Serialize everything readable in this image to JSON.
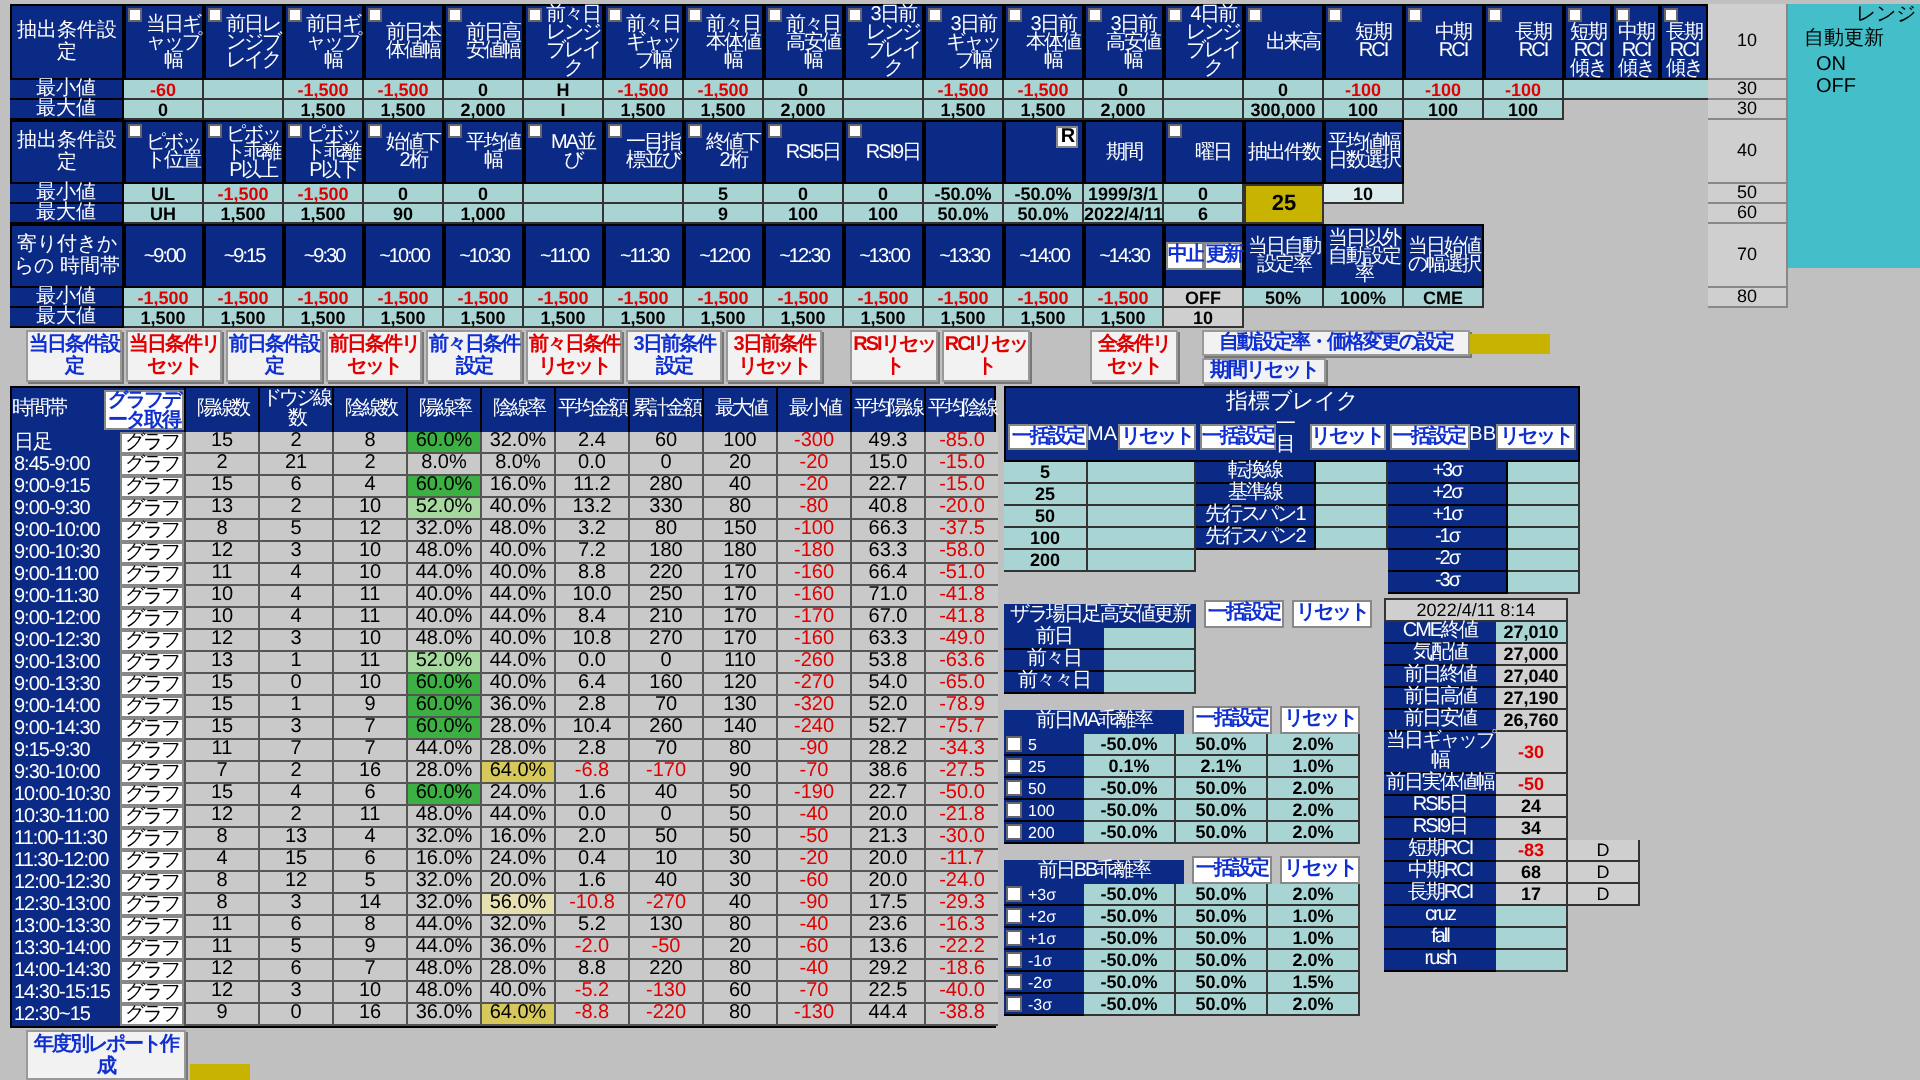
{
  "price_conditions": {
    "title": "抽出条件設定",
    "min_label": "最小値",
    "max_label": "最大値",
    "columns": [
      {
        "label": "当日ギャップ幅",
        "checked": false,
        "min": "-60",
        "min_negative": true,
        "max": "0"
      },
      {
        "label": "前日レンジブレイク",
        "checked": false
      },
      {
        "label": "前日ギャップ幅",
        "checked": false,
        "min": "-1,500",
        "min_negative": true,
        "max": "1,500"
      },
      {
        "label": "前日本体値幅",
        "checked": false,
        "min": "-1,500",
        "min_negative": true,
        "max": "1,500"
      },
      {
        "label": "前日高安値幅",
        "checked": false,
        "min": "0",
        "min_negative": false,
        "max": "2,000"
      },
      {
        "label": "前々日レンジブレイク",
        "checked": false,
        "min": "H",
        "min_negative": false,
        "max": "I"
      },
      {
        "label": "前々日ギャップ幅",
        "checked": false,
        "min": "-1,500",
        "min_negative": true,
        "max": "1,500"
      },
      {
        "label": "前々日本体値幅",
        "checked": false,
        "min": "-1,500",
        "min_negative": true,
        "max": "1,500"
      },
      {
        "label": "前々日高安値幅",
        "checked": false,
        "min": "0",
        "min_negative": false,
        "max": "2,000"
      },
      {
        "label": "3日前レンジブレイク",
        "checked": false
      },
      {
        "label": "3日前ギャップ幅",
        "checked": false,
        "min": "-1,500",
        "min_negative": true,
        "max": "1,500"
      },
      {
        "label": "3日前本体値幅",
        "checked": false,
        "min": "-1,500",
        "min_negative": true,
        "max": "1,500"
      },
      {
        "label": "3日前高安値幅",
        "checked": false,
        "min": "0",
        "min_negative": false,
        "max": "2,000"
      },
      {
        "label": "4日前レンジブレイク",
        "checked": false
      },
      {
        "label": "出来高",
        "checked": false,
        "min": "0",
        "min_negative": false,
        "max": "300,000"
      },
      {
        "label": "短期RCI",
        "checked": false,
        "min": "-100",
        "min_negative": true,
        "max": "100"
      },
      {
        "label": "中期RCI",
        "checked": false,
        "min": "-100",
        "min_negative": true,
        "max": "100"
      },
      {
        "label": "長期RCI",
        "checked": false,
        "min": "-100",
        "min_negative": true,
        "max": "100"
      }
    ],
    "slope_columns": [
      {
        "label": "短期RCI傾き",
        "checked": false
      },
      {
        "label": "中期RCI傾き",
        "checked": false
      },
      {
        "label": "長期RCI傾き",
        "checked": false
      }
    ]
  },
  "pattern_conditions": {
    "title": "抽出条件設定",
    "min_label": "最小値",
    "max_label": "最大値",
    "columns": [
      {
        "kind": "header",
        "label": "ピボット位置",
        "checked": false,
        "min": "UL",
        "min_negative": false,
        "max": "UH"
      },
      {
        "kind": "header",
        "label": "ピボット乖離P以上",
        "checked": false,
        "min": "-1,500",
        "min_negative": true,
        "max": "1,500"
      },
      {
        "kind": "header",
        "label": "ピボット乖離P以下",
        "checked": false,
        "min": "-1,500",
        "min_negative": true,
        "max": "1,500"
      },
      {
        "kind": "header",
        "label": "始値下2桁",
        "checked": false,
        "min": "0",
        "min_negative": false,
        "max": "90"
      },
      {
        "kind": "header",
        "label": "平均値幅",
        "checked": false,
        "min": "0",
        "min_negative": false,
        "max": "1,000"
      },
      {
        "kind": "header",
        "label": "MA並び",
        "checked": false
      },
      {
        "kind": "header",
        "label": "一目指標並び",
        "checked": false
      },
      {
        "kind": "header",
        "label": "終値下2桁",
        "checked": false,
        "min": "5",
        "min_negative": false,
        "max": "9"
      },
      {
        "kind": "header",
        "label": "RSI5日",
        "checked": false,
        "min": "0",
        "min_negative": false,
        "max": "100"
      },
      {
        "kind": "header",
        "label": "RSI9日",
        "checked": false,
        "min": "0",
        "min_negative": false,
        "max": "100"
      },
      {
        "kind": "blank",
        "min": "-50.0%",
        "min_negative": false,
        "max": "50.0%"
      },
      {
        "kind": "button",
        "label": "R",
        "min": "-50.0%",
        "min_negative": false,
        "max": "50.0%"
      },
      {
        "kind": "header",
        "label": "期間",
        "min": "1999/3/1",
        "min_negative": false,
        "max": "2022/4/11"
      },
      {
        "kind": "header",
        "label": "曜日",
        "checked": false,
        "min": "0",
        "min_negative": false,
        "max": "6"
      }
    ],
    "count": {
      "label": "抽出件数",
      "value": "25"
    },
    "avg_days": {
      "label": "平均値幅日数選択",
      "value": "10"
    }
  },
  "time_conditions": {
    "title": "寄り付きからの 時間帯",
    "min_label": "最小値",
    "max_label": "最大値",
    "slots": [
      {
        "label": "~9:00",
        "min": "-1,500",
        "min_negative": true,
        "max": "1,500"
      },
      {
        "label": "~9:15",
        "min": "-1,500",
        "min_negative": true,
        "max": "1,500"
      },
      {
        "label": "~9:30",
        "min": "-1,500",
        "min_negative": true,
        "max": "1,500"
      },
      {
        "label": "~10:00",
        "min": "-1,500",
        "min_negative": true,
        "max": "1,500"
      },
      {
        "label": "~10:30",
        "min": "-1,500",
        "min_negative": true,
        "max": "1,500"
      },
      {
        "label": "~11:00",
        "min": "-1,500",
        "min_negative": true,
        "max": "1,500"
      },
      {
        "label": "~11:30",
        "min": "-1,500",
        "min_negative": true,
        "max": "1,500"
      },
      {
        "label": "~12:00",
        "min": "-1,500",
        "min_negative": true,
        "max": "1,500"
      },
      {
        "label": "~12:30",
        "min": "-1,500",
        "min_negative": true,
        "max": "1,500"
      },
      {
        "label": "~13:00",
        "min": "-1,500",
        "min_negative": true,
        "max": "1,500"
      },
      {
        "label": "~13:30",
        "min": "-1,500",
        "min_negative": true,
        "max": "1,500"
      },
      {
        "label": "~14:00",
        "min": "-1,500",
        "min_negative": true,
        "max": "1,500"
      },
      {
        "label": "~14:30",
        "min": "-1,500",
        "min_negative": true,
        "max": "1,500"
      }
    ],
    "stop_button": "中止",
    "update_button": "更新",
    "mode": "OFF",
    "interval": "10",
    "rates": [
      {
        "label": "当日自動設定率",
        "value": "50%"
      },
      {
        "label": "当日以外自動設定率",
        "value": "100%"
      },
      {
        "label": "当日始値の幅選択",
        "value": "CME"
      }
    ]
  },
  "level_list": [
    "10",
    "30",
    "30",
    "40",
    "50",
    "60",
    "70",
    "80"
  ],
  "auto_update": {
    "range_label": "レンジ",
    "title": "自動更新",
    "options": [
      "ON",
      "OFF"
    ]
  },
  "condition_buttons": [
    {
      "label": "当日条件設定",
      "kind": "set"
    },
    {
      "label": "当日条件リセット",
      "kind": "reset"
    },
    {
      "label": "前日条件設定",
      "kind": "set"
    },
    {
      "label": "前日条件リセット",
      "kind": "reset"
    },
    {
      "label": "前々日条件設定",
      "kind": "set"
    },
    {
      "label": "前々日条件リセット",
      "kind": "reset"
    },
    {
      "label": "3日前条件設定",
      "kind": "set"
    },
    {
      "label": "3日前条件リセット",
      "kind": "reset"
    }
  ],
  "indicator_reset_buttons": [
    {
      "label": "RSIリセット",
      "kind": "reset"
    },
    {
      "label": "RCIリセット",
      "kind": "reset"
    }
  ],
  "all_reset_button": "全条件リセット",
  "auto_rate_button": "自動設定率・価格変更の設定",
  "period_reset_button": "期間リセット",
  "table": {
    "time_header": "時間帯",
    "fetch_button": "グラフデータ取得",
    "columns": [
      {
        "label": "陽線数",
        "kind": "plain"
      },
      {
        "label": "ドウジ線数",
        "kind": "plain"
      },
      {
        "label": "陰線数",
        "kind": "plain"
      },
      {
        "label": "陽線率",
        "kind": "up_rate"
      },
      {
        "label": "陰線率",
        "kind": "down_rate"
      },
      {
        "label": "平均金額",
        "kind": "amount"
      },
      {
        "label": "累計金額",
        "kind": "amount"
      },
      {
        "label": "最大値",
        "kind": "plain"
      },
      {
        "label": "最小値",
        "kind": "negative"
      },
      {
        "label": "平均陽線",
        "kind": "plain"
      },
      {
        "label": "平均陰線",
        "kind": "negative"
      }
    ],
    "rows": [
      {
        "label": "日足",
        "button": "グラフ",
        "cells": [
          "15",
          "2",
          "8",
          "60.0%",
          "32.0%",
          "2.4",
          "60",
          "100",
          "-300",
          "49.3",
          "-85.0"
        ],
        "up_hit": true,
        "up_near": false,
        "down_hit": false,
        "down_near": false,
        "loss": false
      },
      {
        "label": "8:45-9:00",
        "button": "グラフ",
        "cells": [
          "2",
          "21",
          "2",
          "8.0%",
          "8.0%",
          "0.0",
          "0",
          "20",
          "-20",
          "15.0",
          "-15.0"
        ],
        "up_hit": false,
        "up_near": false,
        "down_hit": false,
        "down_near": false,
        "loss": false
      },
      {
        "label": "9:00-9:15",
        "button": "グラフ",
        "cells": [
          "15",
          "6",
          "4",
          "60.0%",
          "16.0%",
          "11.2",
          "280",
          "40",
          "-20",
          "22.7",
          "-15.0"
        ],
        "up_hit": true,
        "up_near": false,
        "down_hit": false,
        "down_near": false,
        "loss": false
      },
      {
        "label": "9:00-9:30",
        "button": "グラフ",
        "cells": [
          "13",
          "2",
          "10",
          "52.0%",
          "40.0%",
          "13.2",
          "330",
          "80",
          "-80",
          "40.8",
          "-20.0"
        ],
        "up_hit": false,
        "up_near": true,
        "down_hit": false,
        "down_near": false,
        "loss": false
      },
      {
        "label": "9:00-10:00",
        "button": "グラフ",
        "cells": [
          "8",
          "5",
          "12",
          "32.0%",
          "48.0%",
          "3.2",
          "80",
          "150",
          "-100",
          "66.3",
          "-37.5"
        ],
        "up_hit": false,
        "up_near": false,
        "down_hit": false,
        "down_near": false,
        "loss": false
      },
      {
        "label": "9:00-10:30",
        "button": "グラフ",
        "cells": [
          "12",
          "3",
          "10",
          "48.0%",
          "40.0%",
          "7.2",
          "180",
          "180",
          "-180",
          "63.3",
          "-58.0"
        ],
        "up_hit": false,
        "up_near": false,
        "down_hit": false,
        "down_near": false,
        "loss": false
      },
      {
        "label": "9:00-11:00",
        "button": "グラフ",
        "cells": [
          "11",
          "4",
          "10",
          "44.0%",
          "40.0%",
          "8.8",
          "220",
          "170",
          "-160",
          "66.4",
          "-51.0"
        ],
        "up_hit": false,
        "up_near": false,
        "down_hit": false,
        "down_near": false,
        "loss": false
      },
      {
        "label": "9:00-11:30",
        "button": "グラフ",
        "cells": [
          "10",
          "4",
          "11",
          "40.0%",
          "44.0%",
          "10.0",
          "250",
          "170",
          "-160",
          "71.0",
          "-41.8"
        ],
        "up_hit": false,
        "up_near": false,
        "down_hit": false,
        "down_near": false,
        "loss": false
      },
      {
        "label": "9:00-12:00",
        "button": "グラフ",
        "cells": [
          "10",
          "4",
          "11",
          "40.0%",
          "44.0%",
          "8.4",
          "210",
          "170",
          "-170",
          "67.0",
          "-41.8"
        ],
        "up_hit": false,
        "up_near": false,
        "down_hit": false,
        "down_near": false,
        "loss": false
      },
      {
        "label": "9:00-12:30",
        "button": "グラフ",
        "cells": [
          "12",
          "3",
          "10",
          "48.0%",
          "40.0%",
          "10.8",
          "270",
          "170",
          "-160",
          "63.3",
          "-49.0"
        ],
        "up_hit": false,
        "up_near": false,
        "down_hit": false,
        "down_near": false,
        "loss": false
      },
      {
        "label": "9:00-13:00",
        "button": "グラフ",
        "cells": [
          "13",
          "1",
          "11",
          "52.0%",
          "44.0%",
          "0.0",
          "0",
          "110",
          "-260",
          "53.8",
          "-63.6"
        ],
        "up_hit": false,
        "up_near": true,
        "down_hit": false,
        "down_near": false,
        "loss": false
      },
      {
        "label": "9:00-13:30",
        "button": "グラフ",
        "cells": [
          "15",
          "0",
          "10",
          "60.0%",
          "40.0%",
          "6.4",
          "160",
          "120",
          "-270",
          "54.0",
          "-65.0"
        ],
        "up_hit": true,
        "up_near": false,
        "down_hit": false,
        "down_near": false,
        "loss": false
      },
      {
        "label": "9:00-14:00",
        "button": "グラフ",
        "cells": [
          "15",
          "1",
          "9",
          "60.0%",
          "36.0%",
          "2.8",
          "70",
          "130",
          "-320",
          "52.0",
          "-78.9"
        ],
        "up_hit": true,
        "up_near": false,
        "down_hit": false,
        "down_near": false,
        "loss": false
      },
      {
        "label": "9:00-14:30",
        "button": "グラフ",
        "cells": [
          "15",
          "3",
          "7",
          "60.0%",
          "28.0%",
          "10.4",
          "260",
          "140",
          "-240",
          "52.7",
          "-75.7"
        ],
        "up_hit": true,
        "up_near": false,
        "down_hit": false,
        "down_near": false,
        "loss": false
      },
      {
        "label": "9:15-9:30",
        "button": "グラフ",
        "cells": [
          "11",
          "7",
          "7",
          "44.0%",
          "28.0%",
          "2.8",
          "70",
          "80",
          "-90",
          "28.2",
          "-34.3"
        ],
        "up_hit": false,
        "up_near": false,
        "down_hit": false,
        "down_near": false,
        "loss": false
      },
      {
        "label": "9:30-10:00",
        "button": "グラフ",
        "cells": [
          "7",
          "2",
          "16",
          "28.0%",
          "64.0%",
          "-6.8",
          "-170",
          "90",
          "-70",
          "38.6",
          "-27.5"
        ],
        "up_hit": false,
        "up_near": false,
        "down_hit": true,
        "down_near": false,
        "loss": true
      },
      {
        "label": "10:00-10:30",
        "button": "グラフ",
        "cells": [
          "15",
          "4",
          "6",
          "60.0%",
          "24.0%",
          "1.6",
          "40",
          "50",
          "-190",
          "22.7",
          "-50.0"
        ],
        "up_hit": true,
        "up_near": false,
        "down_hit": false,
        "down_near": false,
        "loss": false
      },
      {
        "label": "10:30-11:00",
        "button": "グラフ",
        "cells": [
          "12",
          "2",
          "11",
          "48.0%",
          "44.0%",
          "0.0",
          "0",
          "50",
          "-40",
          "20.0",
          "-21.8"
        ],
        "up_hit": false,
        "up_near": false,
        "down_hit": false,
        "down_near": false,
        "loss": false
      },
      {
        "label": "11:00-11:30",
        "button": "グラフ",
        "cells": [
          "8",
          "13",
          "4",
          "32.0%",
          "16.0%",
          "2.0",
          "50",
          "50",
          "-50",
          "21.3",
          "-30.0"
        ],
        "up_hit": false,
        "up_near": false,
        "down_hit": false,
        "down_near": false,
        "loss": false
      },
      {
        "label": "11:30-12:00",
        "button": "グラフ",
        "cells": [
          "4",
          "15",
          "6",
          "16.0%",
          "24.0%",
          "0.4",
          "10",
          "30",
          "-20",
          "20.0",
          "-11.7"
        ],
        "up_hit": false,
        "up_near": false,
        "down_hit": false,
        "down_near": false,
        "loss": false
      },
      {
        "label": "12:00-12:30",
        "button": "グラフ",
        "cells": [
          "8",
          "12",
          "5",
          "32.0%",
          "20.0%",
          "1.6",
          "40",
          "30",
          "-60",
          "20.0",
          "-24.0"
        ],
        "up_hit": false,
        "up_near": false,
        "down_hit": false,
        "down_near": false,
        "loss": false
      },
      {
        "label": "12:30-13:00",
        "button": "グラフ",
        "cells": [
          "8",
          "3",
          "14",
          "32.0%",
          "56.0%",
          "-10.8",
          "-270",
          "40",
          "-90",
          "17.5",
          "-29.3"
        ],
        "up_hit": false,
        "up_near": false,
        "down_hit": false,
        "down_near": true,
        "loss": true
      },
      {
        "label": "13:00-13:30",
        "button": "グラフ",
        "cells": [
          "11",
          "6",
          "8",
          "44.0%",
          "32.0%",
          "5.2",
          "130",
          "80",
          "-40",
          "23.6",
          "-16.3"
        ],
        "up_hit": false,
        "up_near": false,
        "down_hit": false,
        "down_near": false,
        "loss": false
      },
      {
        "label": "13:30-14:00",
        "button": "グラフ",
        "cells": [
          "11",
          "5",
          "9",
          "44.0%",
          "36.0%",
          "-2.0",
          "-50",
          "20",
          "-60",
          "13.6",
          "-22.2"
        ],
        "up_hit": false,
        "up_near": false,
        "down_hit": false,
        "down_near": false,
        "loss": true
      },
      {
        "label": "14:00-14:30",
        "button": "グラフ",
        "cells": [
          "12",
          "6",
          "7",
          "48.0%",
          "28.0%",
          "8.8",
          "220",
          "80",
          "-40",
          "29.2",
          "-18.6"
        ],
        "up_hit": false,
        "up_near": false,
        "down_hit": false,
        "down_near": false,
        "loss": false
      },
      {
        "label": "14:30-15:15",
        "button": "グラフ",
        "cells": [
          "12",
          "3",
          "10",
          "48.0%",
          "40.0%",
          "-5.2",
          "-130",
          "60",
          "-70",
          "22.5",
          "-40.0"
        ],
        "up_hit": false,
        "up_near": false,
        "down_hit": false,
        "down_near": false,
        "loss": true
      },
      {
        "label": "12:30~15",
        "button": "グラフ",
        "cells": [
          "9",
          "0",
          "16",
          "36.0%",
          "64.0%",
          "-8.8",
          "-220",
          "80",
          "-130",
          "44.4",
          "-38.8"
        ],
        "up_hit": false,
        "up_near": false,
        "down_hit": true,
        "down_near": false,
        "loss": true
      }
    ]
  },
  "report_button": "年度別レポート作成",
  "indicator_break": {
    "title": "指標ブレイク",
    "groups": [
      {
        "label": "MA",
        "set_button": "一括設定",
        "reset_button": "リセット",
        "kind": "value_label",
        "rows": [
          "5",
          "25",
          "50",
          "100",
          "200"
        ]
      },
      {
        "label": "一目",
        "set_button": "一括設定",
        "reset_button": "リセット",
        "kind": "name_label",
        "rows": [
          "転換線",
          "基準線",
          "先行スパン1",
          "先行スパン2"
        ]
      },
      {
        "label": "BB",
        "set_button": "一括設定",
        "reset_button": "リセット",
        "kind": "name_label",
        "rows": [
          "+3σ",
          "+2σ",
          "+1σ",
          "-1σ",
          "-2σ",
          "-3σ"
        ]
      }
    ]
  },
  "zaraba": {
    "title": "ザラ場日足高安値更新",
    "set_button": "一括設定",
    "reset_button": "リセット",
    "rows": [
      "前日",
      "前々日",
      "前々々日"
    ]
  },
  "ma_deviation": {
    "title": "前日MA乖離率",
    "set_button": "一括設定",
    "reset_button": "リセット",
    "rows": [
      {
        "label": "5",
        "checked": false,
        "values": [
          "-50.0%",
          "50.0%",
          "2.0%"
        ]
      },
      {
        "label": "25",
        "checked": false,
        "values": [
          "0.1%",
          "2.1%",
          "1.0%"
        ]
      },
      {
        "label": "50",
        "checked": false,
        "values": [
          "-50.0%",
          "50.0%",
          "2.0%"
        ]
      },
      {
        "label": "100",
        "checked": false,
        "values": [
          "-50.0%",
          "50.0%",
          "2.0%"
        ]
      },
      {
        "label": "200",
        "checked": false,
        "values": [
          "-50.0%",
          "50.0%",
          "2.0%"
        ]
      }
    ]
  },
  "bb_deviation": {
    "title": "前日BB乖離率",
    "set_button": "一括設定",
    "reset_button": "リセット",
    "rows": [
      {
        "label": "+3σ",
        "checked": false,
        "values": [
          "-50.0%",
          "50.0%",
          "2.0%"
        ]
      },
      {
        "label": "+2σ",
        "checked": false,
        "values": [
          "-50.0%",
          "50.0%",
          "1.0%"
        ]
      },
      {
        "label": "+1σ",
        "checked": false,
        "values": [
          "-50.0%",
          "50.0%",
          "1.0%"
        ]
      },
      {
        "label": "-1σ",
        "checked": false,
        "values": [
          "-50.0%",
          "50.0%",
          "2.0%"
        ]
      },
      {
        "label": "-2σ",
        "checked": false,
        "values": [
          "-50.0%",
          "50.0%",
          "1.5%"
        ]
      },
      {
        "label": "-3σ",
        "checked": false,
        "values": [
          "-50.0%",
          "50.0%",
          "2.0%"
        ]
      }
    ]
  },
  "market": {
    "timestamp": "2022/4/11 8:14",
    "rows": [
      {
        "label": "CME終値",
        "value": "27,010",
        "kind": "input",
        "negative": false
      },
      {
        "label": "気配値",
        "value": "27,000",
        "kind": "output",
        "negative": false
      },
      {
        "label": "前日終値",
        "value": "27,040",
        "kind": "output",
        "negative": false
      },
      {
        "label": "前日高値",
        "value": "27,190",
        "kind": "output",
        "negative": false
      },
      {
        "label": "前日安値",
        "value": "26,760",
        "kind": "output",
        "negative": false
      },
      {
        "label": "当日ギャップ幅",
        "value": "-30",
        "kind": "output",
        "negative": true
      },
      {
        "label": "前日実体値幅",
        "value": "-50",
        "kind": "output",
        "negative": true
      },
      {
        "label": "RSI5日",
        "value": "24",
        "kind": "output",
        "negative": false
      },
      {
        "label": "RSI9日",
        "value": "34",
        "kind": "output",
        "negative": false
      },
      {
        "label": "短期RCI",
        "value": "-83",
        "kind": "output",
        "negative": true,
        "signal": "D"
      },
      {
        "label": "中期RCI",
        "value": "68",
        "kind": "output",
        "negative": false,
        "signal": "D"
      },
      {
        "label": "長期RCI",
        "value": "17",
        "kind": "output",
        "negative": false,
        "signal": "D"
      },
      {
        "label": "cruz",
        "kind": "input"
      },
      {
        "label": "fall",
        "kind": "input"
      },
      {
        "label": "rush",
        "kind": "input"
      }
    ]
  }
}
